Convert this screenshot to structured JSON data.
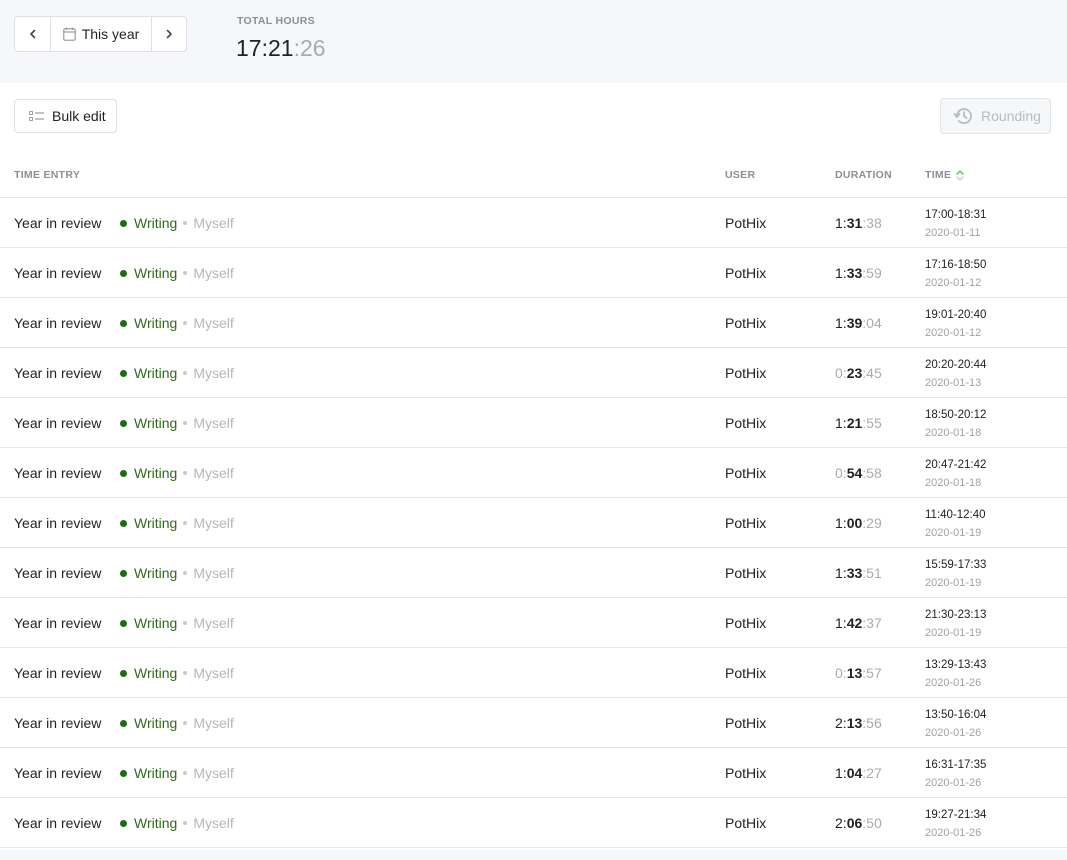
{
  "period": {
    "label": "This year",
    "prev_icon": "chevron-left-icon",
    "next_icon": "chevron-right-icon",
    "calendar_icon": "calendar-icon"
  },
  "total": {
    "label": "TOTAL HOURS",
    "hm": "17:21",
    "sec": ":26"
  },
  "toolbar": {
    "bulk_edit_label": "Bulk edit",
    "rounding_label": "Rounding"
  },
  "table": {
    "headers": {
      "entry": "TIME ENTRY",
      "user": "USER",
      "duration": "DURATION",
      "time": "TIME"
    },
    "rows": [
      {
        "description": "Year in review",
        "project": "Writing",
        "client": "Myself",
        "user": "PotHix",
        "dur_h": "1",
        "dur_m": "31",
        "dur_s": ":38",
        "range": "17:00-18:31",
        "date": "2020-01-11"
      },
      {
        "description": "Year in review",
        "project": "Writing",
        "client": "Myself",
        "user": "PotHix",
        "dur_h": "1",
        "dur_m": "33",
        "dur_s": ":59",
        "range": "17:16-18:50",
        "date": "2020-01-12"
      },
      {
        "description": "Year in review",
        "project": "Writing",
        "client": "Myself",
        "user": "PotHix",
        "dur_h": "1",
        "dur_m": "39",
        "dur_s": ":04",
        "range": "19:01-20:40",
        "date": "2020-01-12"
      },
      {
        "description": "Year in review",
        "project": "Writing",
        "client": "Myself",
        "user": "PotHix",
        "dur_h": "0",
        "dur_m": "23",
        "dur_s": ":45",
        "range": "20:20-20:44",
        "date": "2020-01-13"
      },
      {
        "description": "Year in review",
        "project": "Writing",
        "client": "Myself",
        "user": "PotHix",
        "dur_h": "1",
        "dur_m": "21",
        "dur_s": ":55",
        "range": "18:50-20:12",
        "date": "2020-01-18"
      },
      {
        "description": "Year in review",
        "project": "Writing",
        "client": "Myself",
        "user": "PotHix",
        "dur_h": "0",
        "dur_m": "54",
        "dur_s": ":58",
        "range": "20:47-21:42",
        "date": "2020-01-18"
      },
      {
        "description": "Year in review",
        "project": "Writing",
        "client": "Myself",
        "user": "PotHix",
        "dur_h": "1",
        "dur_m": "00",
        "dur_s": ":29",
        "range": "11:40-12:40",
        "date": "2020-01-19"
      },
      {
        "description": "Year in review",
        "project": "Writing",
        "client": "Myself",
        "user": "PotHix",
        "dur_h": "1",
        "dur_m": "33",
        "dur_s": ":51",
        "range": "15:59-17:33",
        "date": "2020-01-19"
      },
      {
        "description": "Year in review",
        "project": "Writing",
        "client": "Myself",
        "user": "PotHix",
        "dur_h": "1",
        "dur_m": "42",
        "dur_s": ":37",
        "range": "21:30-23:13",
        "date": "2020-01-19"
      },
      {
        "description": "Year in review",
        "project": "Writing",
        "client": "Myself",
        "user": "PotHix",
        "dur_h": "0",
        "dur_m": "13",
        "dur_s": ":57",
        "range": "13:29-13:43",
        "date": "2020-01-26"
      },
      {
        "description": "Year in review",
        "project": "Writing",
        "client": "Myself",
        "user": "PotHix",
        "dur_h": "2",
        "dur_m": "13",
        "dur_s": ":56",
        "range": "13:50-16:04",
        "date": "2020-01-26"
      },
      {
        "description": "Year in review",
        "project": "Writing",
        "client": "Myself",
        "user": "PotHix",
        "dur_h": "1",
        "dur_m": "04",
        "dur_s": ":27",
        "range": "16:31-17:35",
        "date": "2020-01-26"
      },
      {
        "description": "Year in review",
        "project": "Writing",
        "client": "Myself",
        "user": "PotHix",
        "dur_h": "2",
        "dur_m": "06",
        "dur_s": ":50",
        "range": "19:27-21:34",
        "date": "2020-01-26"
      }
    ]
  },
  "colors": {
    "project_dot": "#1e6b12",
    "project_text": "#2e6b16",
    "client_text": "#b3b7bc",
    "topbar_bg": "#f5f7fa",
    "sort_icon": "#5cb85c"
  }
}
